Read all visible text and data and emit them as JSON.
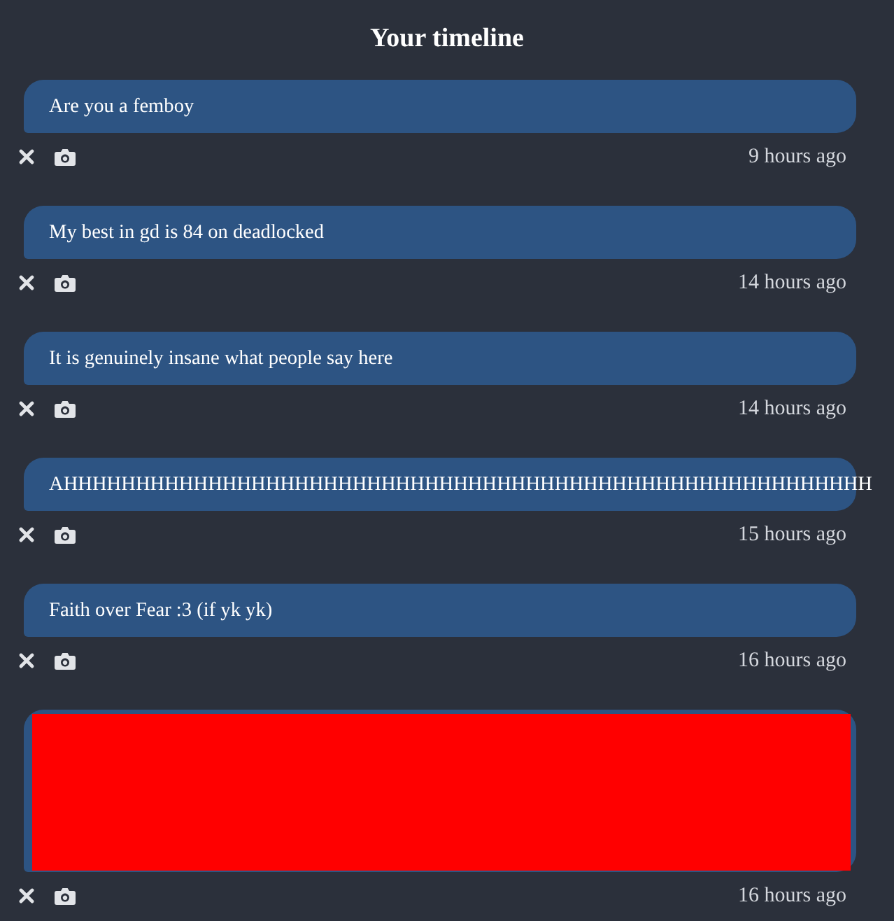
{
  "title": "Your timeline",
  "posts": [
    {
      "kind": "text",
      "text": "Are you a femboy",
      "time": "9 hours ago"
    },
    {
      "kind": "text",
      "text": "My best in gd is 84 on deadlocked",
      "time": "14 hours ago"
    },
    {
      "kind": "text",
      "text": "It is genuinely insane what people say here",
      "time": "14 hours ago"
    },
    {
      "kind": "text",
      "text": "AHHHHHHHHHHHHHHHHHHHHHHHHHHHHHHHHHHHHHHHHHHHHHHHHHHHHHHHH",
      "time": "15 hours ago"
    },
    {
      "kind": "text",
      "text": "Faith over Fear :3 (if yk yk)",
      "time": "16 hours ago"
    },
    {
      "kind": "image",
      "time": "16 hours ago"
    }
  ]
}
